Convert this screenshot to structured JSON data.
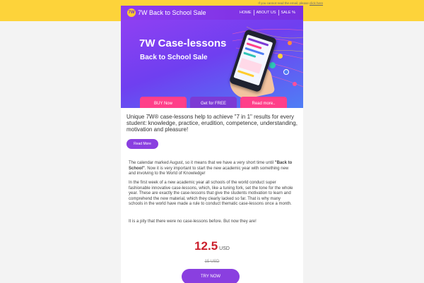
{
  "preheader": {
    "text": "If you cannot read the email, please",
    "link": "click here"
  },
  "header": {
    "logo_text": "7W",
    "brand": "7W Back to School Sale",
    "nav": [
      "HOME",
      "ABOUT US",
      "SALE %"
    ]
  },
  "hero": {
    "title": "7W Case-lessons",
    "subtitle": "Back to School Sale",
    "buttons": [
      "BUY Now",
      "Get for FREE",
      "Read more.."
    ]
  },
  "intro": "Unique 7W® case-lessons help to achieve \"7 in 1\" results for every student: knowledge, practice, erudition, competence, understanding, motivation and pleasure!",
  "read_more": "Read More",
  "paragraphs": {
    "p1_a": "The calendar marked August, so it means that we have a very short time until",
    "p1_bold": "\"Back to School\"",
    "p1_b": ". Now it is very important to start the new academic year with something new and involving to the World of Knowledge!",
    "p2": "In the first week of a new academic year all schools of the world conduct super fashionable innovative case-lessons, which, like a tuning fork, set the tone for the whole year. These are exactly the case-lessons that give the students motivation to learn and comprehend the new material, which they clearly lacked so far. That is why many schools in the world have made a rule to conduct thematic case-lessons once a month.",
    "p3": "It is a pity that there were no case-lessons before. But now they are!"
  },
  "price": {
    "value": "12.5",
    "currency": "USD",
    "old": "15 USD"
  },
  "cta": "TRY NOW",
  "colors": {
    "top_band": "#fdd33a",
    "brand_violet": "#8a3fe0",
    "pink": "#ff3f89",
    "price_red": "#cb1f2c"
  }
}
